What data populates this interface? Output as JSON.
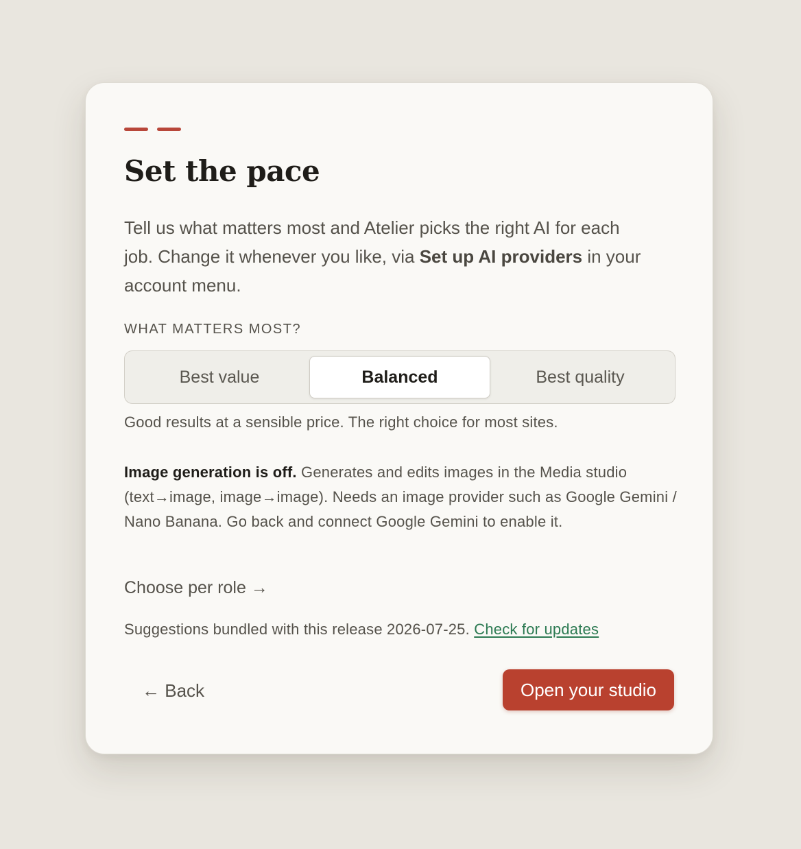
{
  "dialog": {
    "title": "Set the pace",
    "intro": {
      "part1": "Tell us what matters most and Atelier picks the right AI for each job. Change it whenever you like, via ",
      "link_text": "Set up AI providers",
      "part2": " in your account menu."
    },
    "section_label": "WHAT MATTERS MOST?",
    "options": [
      {
        "label": "Best value",
        "selected": false
      },
      {
        "label": "Balanced",
        "selected": true
      },
      {
        "label": "Best quality",
        "selected": false
      }
    ],
    "option_hint": "Good results at a sensible price. The right choice for most sites.",
    "image_notice": {
      "heading": "Image generation is off.",
      "body": " Generates and edits images in the Media studio (text→image, image→image). Needs an image provider such as Google Gemini / Nano Banana. Go back and connect Google Gemini to enable it."
    },
    "choose_per_role": "Choose per role →",
    "suggestions": {
      "text": "Suggestions bundled with this release 2026-07-25. ",
      "link": "Check for updates"
    },
    "back_label": "← Back",
    "primary_label": "Open your studio"
  },
  "colors": {
    "accent": "#b8473a",
    "primary_button": "#b9412f",
    "link": "#2c7a52"
  }
}
